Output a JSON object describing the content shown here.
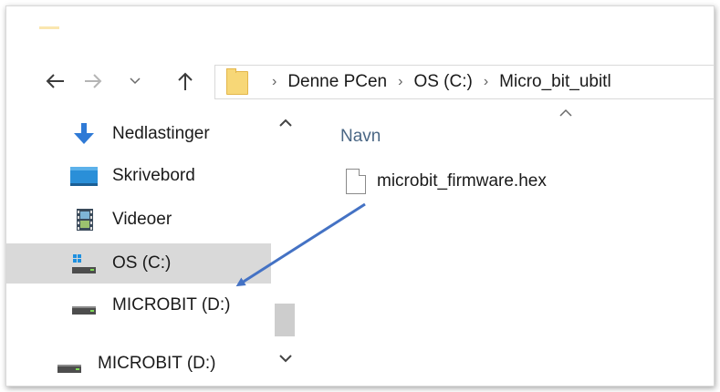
{
  "nav": {
    "back_icon": "arrow-left-icon",
    "forward_icon": "arrow-right-icon",
    "recent_icon": "chevron-down-icon",
    "up_icon": "arrow-up-icon"
  },
  "address": {
    "crumbs": [
      "Denne PCen",
      "OS (C:)",
      "Micro_bit_ubitl"
    ]
  },
  "sidebar": {
    "items": [
      {
        "label": "Nedlastinger",
        "icon": "download-icon"
      },
      {
        "label": "Skrivebord",
        "icon": "desktop-icon"
      },
      {
        "label": "Videoer",
        "icon": "video-icon"
      },
      {
        "label": "OS (C:)",
        "icon": "os-drive-icon",
        "selected": true
      },
      {
        "label": "MICROBIT (D:)",
        "icon": "drive-icon"
      },
      {
        "label": "MICROBIT (D:)",
        "icon": "drive-icon"
      }
    ]
  },
  "content": {
    "column_header": "Navn",
    "files": [
      {
        "name": "microbit_firmware.hex",
        "icon": "file-icon"
      }
    ]
  },
  "annotation": {
    "arrow_color": "#4472c4"
  }
}
